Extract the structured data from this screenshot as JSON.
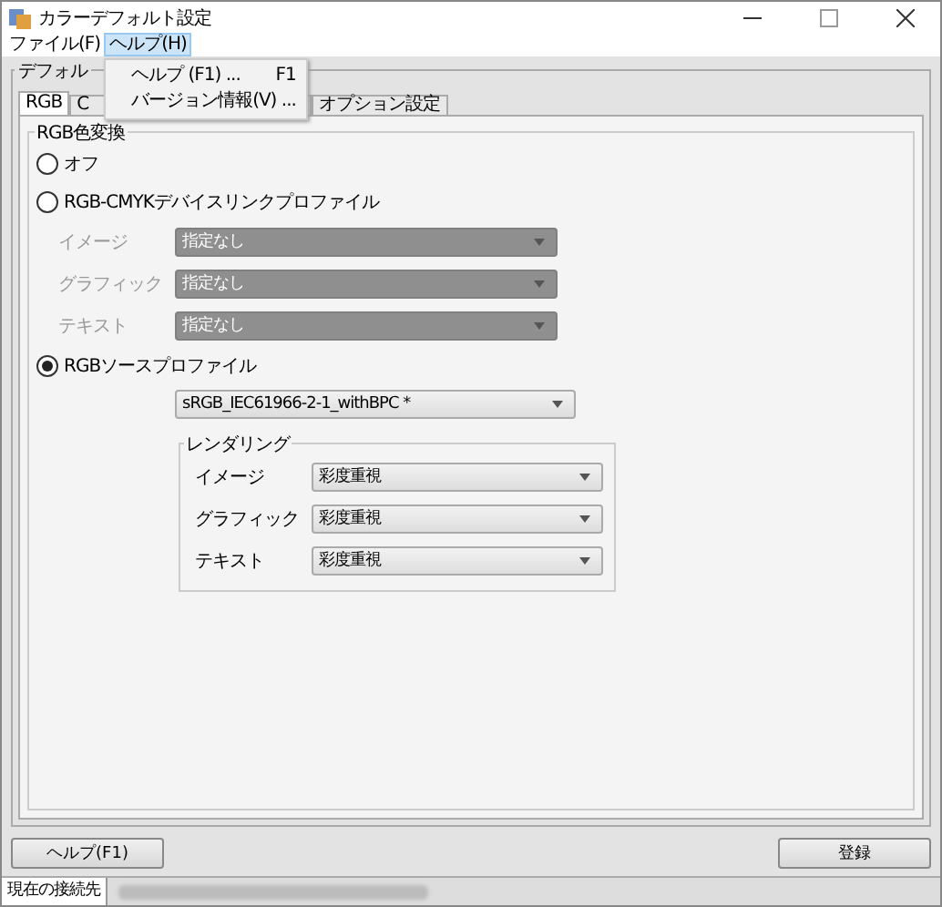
{
  "window": {
    "title": "カラーデフォルト設定"
  },
  "menu_bar": [
    {
      "label": "ファイル(F)",
      "selected": false
    },
    {
      "label": "ヘルプ(H)",
      "selected": true
    }
  ],
  "open_menu": {
    "items": [
      {
        "label": "ヘルプ (F1) ...",
        "shortcut": "F1"
      },
      {
        "label": "バージョン情報(V) ..."
      }
    ]
  },
  "group_title": "デフォル",
  "tabs": [
    {
      "label": "RGB",
      "selected": true
    },
    {
      "label": "C",
      "selected": false
    },
    {
      "label": "オプション設定",
      "selected": false
    }
  ],
  "section_title": "RGB色変換",
  "options": [
    {
      "label": "オフ",
      "selected": false
    },
    {
      "label": "RGB-CMYKデバイスリンクプロファイル",
      "selected": false,
      "fields": [
        {
          "label": "イメージ",
          "value": "指定なし",
          "disabled": true
        },
        {
          "label": "グラフィック",
          "value": "指定なし",
          "disabled": true
        },
        {
          "label": "テキスト",
          "value": "指定なし",
          "disabled": true
        }
      ]
    },
    {
      "label": "RGBソースプロファイル",
      "selected": true,
      "profile": "sRGB_IEC61966-2-1_withBPC  *",
      "rendering": {
        "title": "レンダリング",
        "fields": [
          {
            "label": "イメージ",
            "value": "彩度重視",
            "disabled": false
          },
          {
            "label": "グラフィック",
            "value": "彩度重視",
            "disabled": false
          },
          {
            "label": "テキスト",
            "value": "彩度重視",
            "disabled": false
          }
        ]
      }
    }
  ],
  "buttons": [
    "ヘルプ(F1)",
    "登録"
  ],
  "status_bar": {
    "label": "現在の接続先"
  }
}
